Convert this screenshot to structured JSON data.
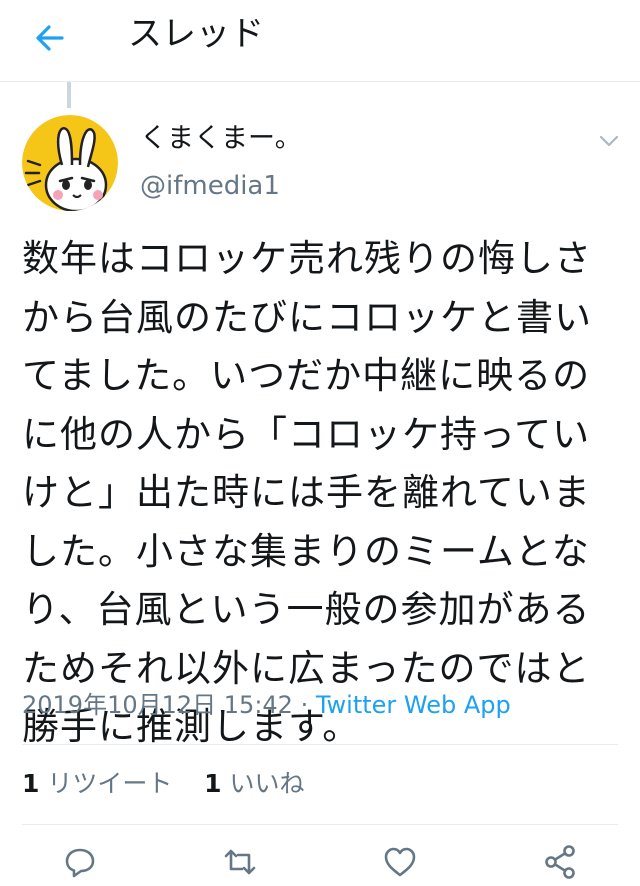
{
  "header": {
    "title": "スレッド"
  },
  "tweet": {
    "display_name": "くまくまー。",
    "handle": "@ifmedia1",
    "lines": [
      "数年はコロッケ売れ残りの悔しさ",
      "から台風のたびにコロッケと書い",
      "てました。いつだか中継に映るの",
      "に他の人から「コロッケ持ってい",
      "けと」出た時には手を離れていま",
      "した。小さな集まりのミームとな",
      "り、台風という一般の参加がある",
      "ためそれ以外に広まったのではと",
      "勝手に推測します。"
    ],
    "timestamp": "2019年10月12日 15:42",
    "separator": " · ",
    "source": "Twitter Web App"
  },
  "stats": {
    "retweet_count": "1",
    "retweet_label": "リツイート",
    "like_count": "1",
    "like_label": "いいね"
  },
  "colors": {
    "accent": "#1da1f2",
    "muted": "#657786",
    "text": "#14171a",
    "border": "#e6ecf0"
  },
  "icons": [
    "back-arrow-icon",
    "chevron-down-icon",
    "reply-icon",
    "retweet-icon",
    "like-icon",
    "share-icon"
  ]
}
